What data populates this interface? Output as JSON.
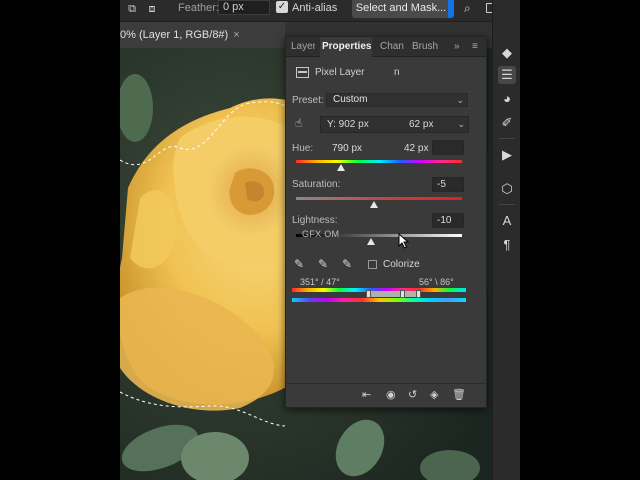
{
  "options_bar": {
    "feather_label": "Feather:",
    "feather_value": "0 px",
    "antialias_label": "Anti-alias",
    "select_mask_label": "Select and Mask..."
  },
  "document_tab": {
    "title": "0% (Layer 1, RGB/8#)",
    "close": "×"
  },
  "panel": {
    "tabs": [
      "Layer",
      "Properties",
      "Chan",
      "Brush"
    ],
    "overflow": "»",
    "menu": "≡",
    "pixel_layer": "Pixel Layer",
    "pixel_layer_extra": "n",
    "preset_label": "Preset:",
    "preset_value": "Custom",
    "channel_y": "Y: 902 px",
    "channel_v2": "62 px",
    "hue_label": "Hue:",
    "hue_px1": "790 px",
    "hue_px2": "42 px",
    "hue_value": "",
    "saturation_label": "Saturation:",
    "saturation_value": "-5",
    "lightness_label": "Lightness:",
    "lightness_value": "-10",
    "watermark": "GFX OM",
    "colorize_label": "Colorize",
    "range_left": "351° / 47°",
    "range_right": "56° \\ 86°",
    "slider_levels": {
      "hue": 0.27,
      "saturation": 0.47,
      "lightness": 0.45
    }
  },
  "colors": {
    "accent": "#1473e6",
    "panel_bg": "#3a3a3a",
    "app_bg": "#323232"
  },
  "icons": {
    "toolbar_right": [
      "layers-icon",
      "adjustments-icon",
      "color-icon",
      "brush-settings-icon",
      "play-icon",
      "3d-box-icon",
      "character-icon",
      "paragraph-icon"
    ],
    "panel_footer": [
      "clip-to-layer-icon",
      "view-previous-icon",
      "reset-icon",
      "visibility-icon",
      "delete-icon"
    ]
  }
}
